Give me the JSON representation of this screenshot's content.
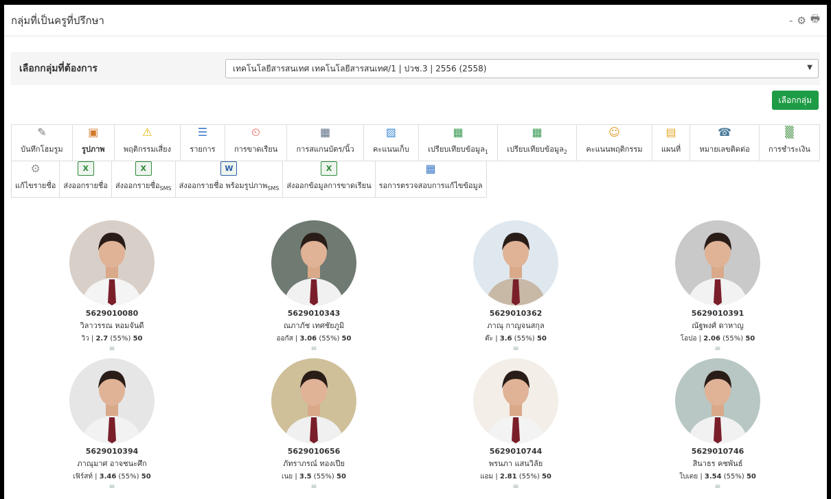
{
  "page_title": "กลุ่มที่เป็นครูที่ปรึกษา",
  "window_controls": {
    "minimize": "-",
    "print": "🖶",
    "settings": "⚙"
  },
  "selector": {
    "label": "เลือกกลุ่มที่ต้องการ",
    "value": "เทคโนโลยีสารสนเทศ เทคโนโลยีสารสนเทศ/1 | ปวช.3 | 2556 (2558)",
    "button": "เลือกกลุ่ม"
  },
  "toolbar_row1": [
    {
      "label": "บันทึกโฮมรูม",
      "icon": "home-record-icon",
      "glyph": "✎",
      "color": "#7a7a7a",
      "bold": false
    },
    {
      "label": "รูปภาพ",
      "icon": "picture-icon",
      "glyph": "▣",
      "color": "#d27a2c",
      "bold": true
    },
    {
      "label": "พฤติกรรมเสี่ยง",
      "icon": "warning-icon",
      "glyph": "⚠",
      "color": "#e3b400",
      "bold": false
    },
    {
      "label": "รายการ",
      "icon": "list-icon",
      "glyph": "☰",
      "color": "#3a78c8",
      "bold": false
    },
    {
      "label": "การขาดเรียน",
      "icon": "absence-icon",
      "glyph": "⏲",
      "color": "#d8402c",
      "bold": false
    },
    {
      "label": "การสแกนบัตร/นิ้ว",
      "icon": "calendar-icon",
      "glyph": "▦",
      "color": "#5d6e86",
      "bold": false
    },
    {
      "label": "คะแนนเก็บ",
      "icon": "score-chart-icon",
      "glyph": "▨",
      "color": "#3b8ad3",
      "bold": false
    },
    {
      "label": "เปรียบเทียบข้อมูล",
      "sub": "1",
      "icon": "compare-1-icon",
      "glyph": "▦",
      "color": "#3a9a52",
      "bold": false
    },
    {
      "label": "เปรียบเทียบข้อมูล",
      "sub": "2",
      "icon": "compare-2-icon",
      "glyph": "▦",
      "color": "#3a9a52",
      "bold": false
    },
    {
      "label": "คะแนนพฤติกรรม",
      "icon": "behavior-score-icon",
      "glyph": "☺",
      "color": "#e09a2a",
      "bold": false
    },
    {
      "label": "แผนที่",
      "icon": "map-icon",
      "glyph": "▤",
      "color": "#e0a82a",
      "bold": false
    },
    {
      "label": "หมายเลขติดต่อ",
      "icon": "contact-icon",
      "glyph": "☎",
      "color": "#4a7a9a",
      "bold": false
    },
    {
      "label": "การชำระเงิน",
      "icon": "payment-icon",
      "glyph": "▒",
      "color": "#3a8a3a",
      "bold": false
    }
  ],
  "toolbar_row2": [
    {
      "label": "แก้ไขรายชื่อ",
      "icon": "edit-names-icon",
      "glyph": "⚙",
      "color": "#999"
    },
    {
      "label": "ส่งออกรายชื่อ",
      "icon": "xls-export-icon",
      "glyph": "X",
      "color": "#2f8a3a"
    },
    {
      "label": "ส่งออกรายชื่อ",
      "sub": "SMS",
      "icon": "xls-sms-export-icon",
      "glyph": "X",
      "color": "#2f8a3a"
    },
    {
      "label": "ส่งออกรายชื่อ พร้อมรูปภาพ",
      "sub": "SMS",
      "icon": "doc-export-icon",
      "glyph": "W",
      "color": "#2e5ea8"
    },
    {
      "label": "ส่งออกข้อมูลการขาดเรียน",
      "icon": "xls-absence-export-icon",
      "glyph": "X",
      "color": "#2f8a3a"
    },
    {
      "label": "รอการตรวจสอบการแก้ไขข้อมูล",
      "icon": "pending-review-icon",
      "glyph": "▦",
      "color": "#3a78c8"
    }
  ],
  "students": [
    {
      "id": "5629010080",
      "name": "วิลาวรรณ หอมจันดี",
      "nick": "วิว",
      "gpa": "2.7",
      "pct": "(55%)",
      "score": "50",
      "bg": "#d8cfc8",
      "shirt": "#f4f4f4"
    },
    {
      "id": "5629010343",
      "name": "ณภาภัช เทศชัยภูมิ",
      "nick": "ออกัส",
      "gpa": "3.06",
      "pct": "(55%)",
      "score": "50",
      "bg": "#6f7a72",
      "shirt": "#f1f1f1"
    },
    {
      "id": "5629010362",
      "name": "ภาณุ กาญจนสกุล",
      "nick": "ต๊ะ",
      "gpa": "3.6",
      "pct": "(55%)",
      "score": "50",
      "bg": "#dfe8ee",
      "shirt": "#c8b8a6"
    },
    {
      "id": "5629010391",
      "name": "ณัฐพงศ์ ดาหาญ",
      "nick": "โอปอ",
      "gpa": "2.06",
      "pct": "(55%)",
      "score": "50",
      "bg": "#c9c9c9",
      "shirt": "#f2f2f2"
    },
    {
      "id": "5629010394",
      "name": "ภาณุมาศ อาจชนะศึก",
      "nick": "เฟิร์สท์",
      "gpa": "3.46",
      "pct": "(55%)",
      "score": "50",
      "bg": "#e6e6e6",
      "shirt": "#f2f2f2"
    },
    {
      "id": "5629010656",
      "name": "ภัทราภรณ์ ทองเปีย",
      "nick": "เนย",
      "gpa": "3.5",
      "pct": "(55%)",
      "score": "50",
      "bg": "#cfc09a",
      "shirt": "#f0f0f0"
    },
    {
      "id": "5629010744",
      "name": "พรนภา แสนวิลัย",
      "nick": "แอม",
      "gpa": "2.81",
      "pct": "(55%)",
      "score": "50",
      "bg": "#f3eee8",
      "shirt": "#f3f3f3"
    },
    {
      "id": "5629010746",
      "name": "สินาธร คชพันธ์",
      "nick": "ใบเตย",
      "gpa": "3.54",
      "pct": "(55%)",
      "score": "50",
      "bg": "#b8c7c4",
      "shirt": "#f1f1f1"
    }
  ]
}
